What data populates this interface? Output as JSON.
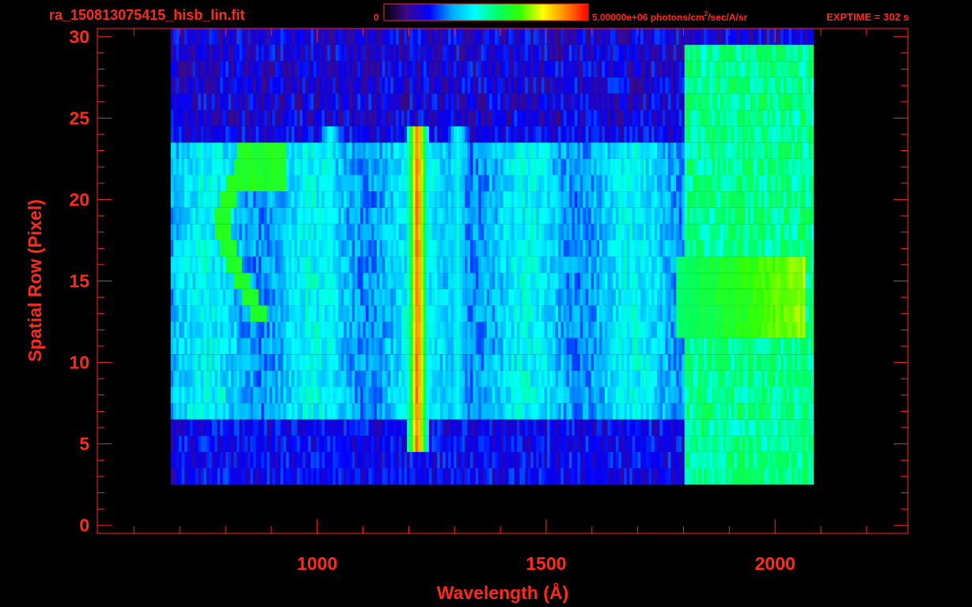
{
  "header": {
    "filename": "ra_150813075415_hisb_lin.fit",
    "colorbar_min_label": "0",
    "colorbar_max_label": "5.00000e+06 photons/cm",
    "colorbar_max_sup": "2",
    "colorbar_max_suffix": "/sec/A/sr",
    "exptime": "EXPTIME = 302 s"
  },
  "colors": {
    "background": "#000000",
    "axis": "#ff2a1a",
    "colormap": [
      "#000000",
      "#3a0a8c",
      "#0000ff",
      "#00aaff",
      "#00ffff",
      "#00ff66",
      "#33ff00",
      "#ffff00",
      "#ff8800",
      "#ff0000"
    ]
  },
  "chart_data": {
    "type": "heatmap",
    "title": "ra_150813075415_hisb_lin.fit",
    "xlabel": "Wavelength (Å)",
    "ylabel": "Spatial Row (Pixel)",
    "xlim": [
      520,
      2290
    ],
    "ylim": [
      -0.5,
      30.5
    ],
    "xticks": [
      1000,
      1500,
      2000
    ],
    "yticks": [
      0,
      5,
      10,
      15,
      20,
      25,
      30
    ],
    "grid": false,
    "colorbar": {
      "min": 0,
      "max": 5000000,
      "unit": "photons/cm²/sec/A/sr",
      "scale": "linear"
    },
    "data_extent": {
      "x": [
        680,
        2080
      ],
      "rows": [
        3,
        30
      ]
    },
    "features": [
      {
        "kind": "emission-line",
        "wavelength": 1216,
        "rows": [
          5,
          24
        ],
        "peak": 0.92
      },
      {
        "kind": "emission-line",
        "wavelength": 1026,
        "rows": [
          7,
          24
        ],
        "peak": 0.45
      },
      {
        "kind": "emission-line",
        "wavelength": 1304,
        "rows": [
          7,
          24
        ],
        "peak": 0.45
      },
      {
        "kind": "arc",
        "wavelength_range": [
          790,
          920
        ],
        "rows": [
          13,
          23
        ],
        "peak": 0.6
      },
      {
        "kind": "band",
        "wavelength_range": [
          1780,
          2060
        ],
        "rows": [
          12,
          16
        ],
        "peak": 0.7
      }
    ]
  }
}
